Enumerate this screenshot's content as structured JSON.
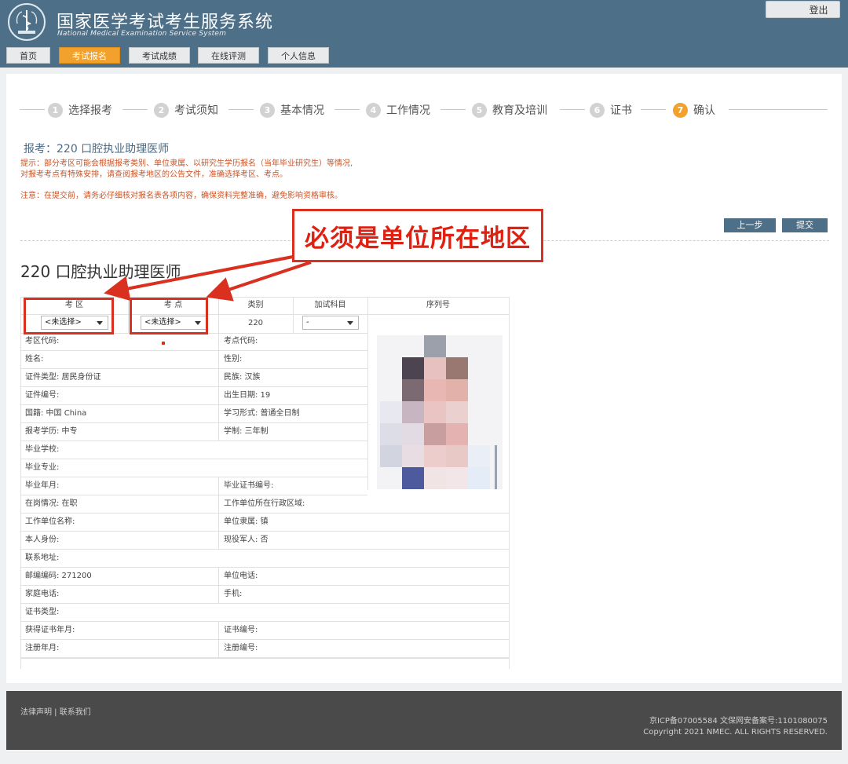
{
  "header": {
    "title": "国家医学考试考生服务系统",
    "subtitle": "National Medical Examination Service System",
    "logout": "登出",
    "nav": [
      {
        "label": "首页",
        "active": false
      },
      {
        "label": "考试报名",
        "active": true
      },
      {
        "label": "考试成绩",
        "active": false
      },
      {
        "label": "在线评测",
        "active": false
      },
      {
        "label": "个人信息",
        "active": false
      }
    ]
  },
  "steps": [
    {
      "num": "1",
      "label": "选择报考"
    },
    {
      "num": "2",
      "label": "考试须知"
    },
    {
      "num": "3",
      "label": "基本情况"
    },
    {
      "num": "4",
      "label": "工作情况"
    },
    {
      "num": "5",
      "label": "教育及培训"
    },
    {
      "num": "6",
      "label": "证书"
    },
    {
      "num": "7",
      "label": "确认"
    }
  ],
  "apply_title": "报考：220 口腔执业助理医师",
  "tips": {
    "line1": "提示：部分考区可能会根据报考类别、单位隶属、以研究生学历报名（当年毕业研究生）等情况,",
    "line2": "对报考考点有特殊安排，请查阅报考地区的公告文件，准确选择考区、考点。",
    "note": "注意：在提交前，请务必仔细核对报名表各项内容，确保资料完整准确，避免影响资格审核。"
  },
  "buttons": {
    "prev": "上一步",
    "submit": "提交"
  },
  "annotation": "必须是单位所在地区",
  "exam_title": "220 口腔执业助理医师",
  "table": {
    "headers": {
      "zone": "考 区",
      "site": "考 点",
      "category": "类别",
      "extra": "加试科目",
      "serial": "序列号"
    },
    "zone_select": "<未选择>",
    "site_select": "<未选择>",
    "category_value": "220",
    "extra_select": "-",
    "rows": [
      {
        "l": "考区代码:",
        "r": "考点代码:"
      },
      {
        "l": "姓名:",
        "r": "性别:"
      },
      {
        "l": "证件类型:  居民身份证",
        "r": "民族:  汉族"
      },
      {
        "l": "证件编号:",
        "r": "出生日期:  19"
      },
      {
        "l": "国籍:  中国 China",
        "r": "学习形式:  普通全日制"
      },
      {
        "l": "报考学历:  中专",
        "r": "学制:   三年制"
      },
      {
        "l": "毕业学校:",
        "r": ""
      },
      {
        "l": "毕业专业:",
        "r": ""
      },
      {
        "l": "毕业年月:",
        "r": "毕业证书编号:"
      },
      {
        "l": "在岗情况:  在职",
        "r": "工作单位所在行政区域:"
      },
      {
        "l": "工作单位名称:",
        "r": "单位隶属:  镇"
      },
      {
        "l": "本人身份:",
        "r": "现役军人:  否"
      },
      {
        "l": "联系地址:",
        "r": ""
      },
      {
        "l": "邮编编码:  271200",
        "r": "单位电话:"
      },
      {
        "l": "家庭电话:",
        "r": "手机:"
      },
      {
        "l": "证书类型:",
        "r": ""
      },
      {
        "l": "获得证书年月:",
        "r": "证书编号:"
      },
      {
        "l": "注册年月:",
        "r": "注册编号:"
      }
    ]
  },
  "footer": {
    "links": "法律声明 | 联系我们",
    "icp": "京ICP备07005584 文保网安备案号:1101080075",
    "copyright": "Copyright 2021 NMEC. ALL RIGHTS RESERVED."
  },
  "colors": {
    "header": "#4e6f88",
    "accent": "#f2a22c",
    "annotation": "#d9301f",
    "tip": "#c8552a"
  }
}
